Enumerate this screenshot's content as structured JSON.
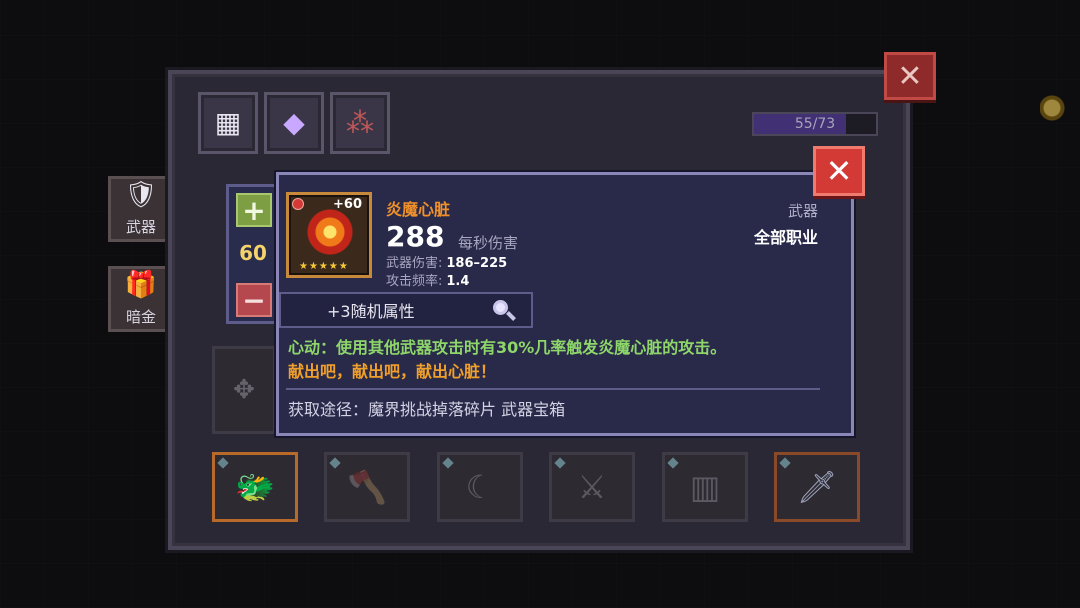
{
  "inventory": {
    "counter": "55/73",
    "counter_fill": 0.75,
    "tabs": [
      {
        "name": "grid-category",
        "icon": "four-squares-icon"
      },
      {
        "name": "gem-category",
        "icon": "crystal-icon"
      },
      {
        "name": "orbs-category",
        "icon": "three-orbs-icon"
      }
    ],
    "side_tabs": [
      {
        "label": "武器",
        "icon": "shield-icon"
      },
      {
        "label": "暗金",
        "icon": "chest-icon"
      }
    ],
    "slots": [
      "dragon-icon",
      "axe-icon",
      "claw-icon",
      "blade-icon",
      "armor-icon",
      "sword-icon"
    ]
  },
  "stepper": {
    "plus": "+",
    "minus": "−",
    "level": "60"
  },
  "item": {
    "name": "炎魔心脏",
    "bonus": "+60",
    "stars": "★★★★★",
    "dps": "288",
    "dps_label": "每秒伤害",
    "damage_label": "武器伤害:",
    "damage_value": "186–225",
    "rate_label": "攻击频率:",
    "rate_value": "1.4",
    "type": "武器",
    "class": "全部职业",
    "random_attr": "+3随机属性",
    "effect": "心动：使用其他武器攻击时有30%几率触发炎魔心脏的攻击。",
    "flavor": "献出吧，献出吧，献出心脏！",
    "source": "获取途径：魔界挑战掉落碎片 武器宝箱"
  },
  "close_symbol": "✕",
  "colors": {
    "name_orange": "#f0902a",
    "effect_green": "#8ed66a",
    "level_yellow": "#f3d36a",
    "close_red": "#d33a36"
  }
}
